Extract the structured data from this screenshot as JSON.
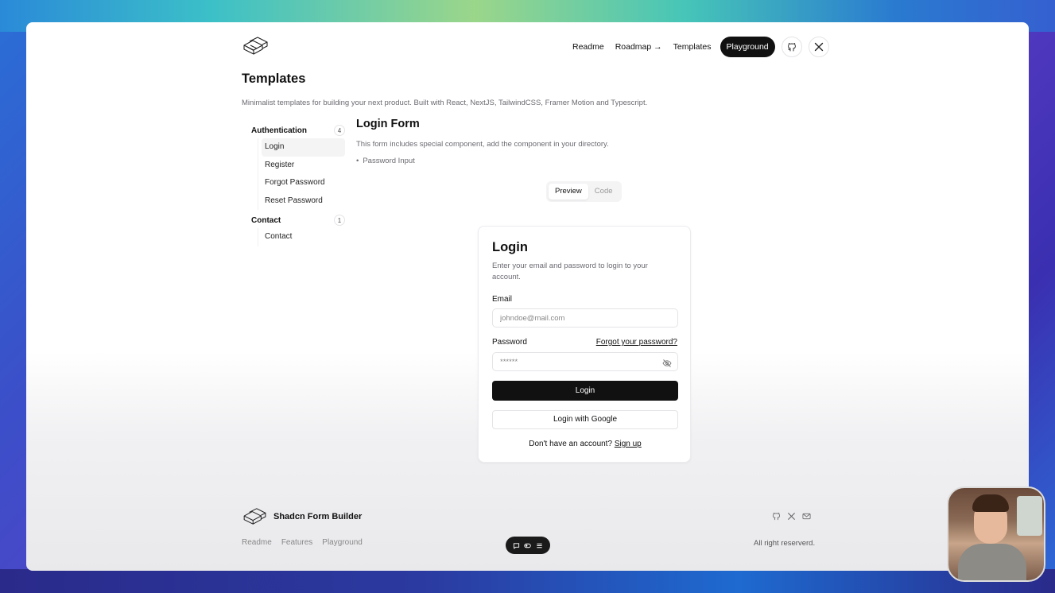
{
  "header": {
    "nav": [
      "Readme",
      "Roadmap →",
      "Templates"
    ],
    "playground_label": "Playground"
  },
  "page": {
    "title": "Templates",
    "subtitle": "Minimalist templates for building your next product. Built with React, NextJS, TailwindCSS, Framer Motion and Typescript."
  },
  "sidebar": {
    "groups": [
      {
        "label": "Authentication",
        "count": "4",
        "items": [
          "Login",
          "Register",
          "Forgot Password",
          "Reset Password"
        ]
      },
      {
        "label": "Contact",
        "count": "1",
        "items": [
          "Contact"
        ]
      }
    ],
    "active_item": "Login"
  },
  "content": {
    "title": "Login Form",
    "description": "This form includes special component, add the component in your directory.",
    "bullet": "Password Input",
    "tabs": [
      "Preview",
      "Code"
    ],
    "active_tab": "Preview"
  },
  "login_card": {
    "title": "Login",
    "description": "Enter your email and password to login to your account.",
    "email_label": "Email",
    "email_placeholder": "johndoe@mail.com",
    "password_label": "Password",
    "forgot_label": "Forgot your password?",
    "password_placeholder": "******",
    "login_button": "Login",
    "google_button": "Login with Google",
    "signup_prompt": "Don't have an account?",
    "signup_link": "Sign up"
  },
  "footer": {
    "brand": "Shadcn Form Builder",
    "links": [
      "Readme",
      "Features",
      "Playground"
    ],
    "copyright": "All right reserverd."
  },
  "colors": {
    "primary": "#111111",
    "muted_text": "#6b6b73",
    "border": "#e4e4e7"
  }
}
